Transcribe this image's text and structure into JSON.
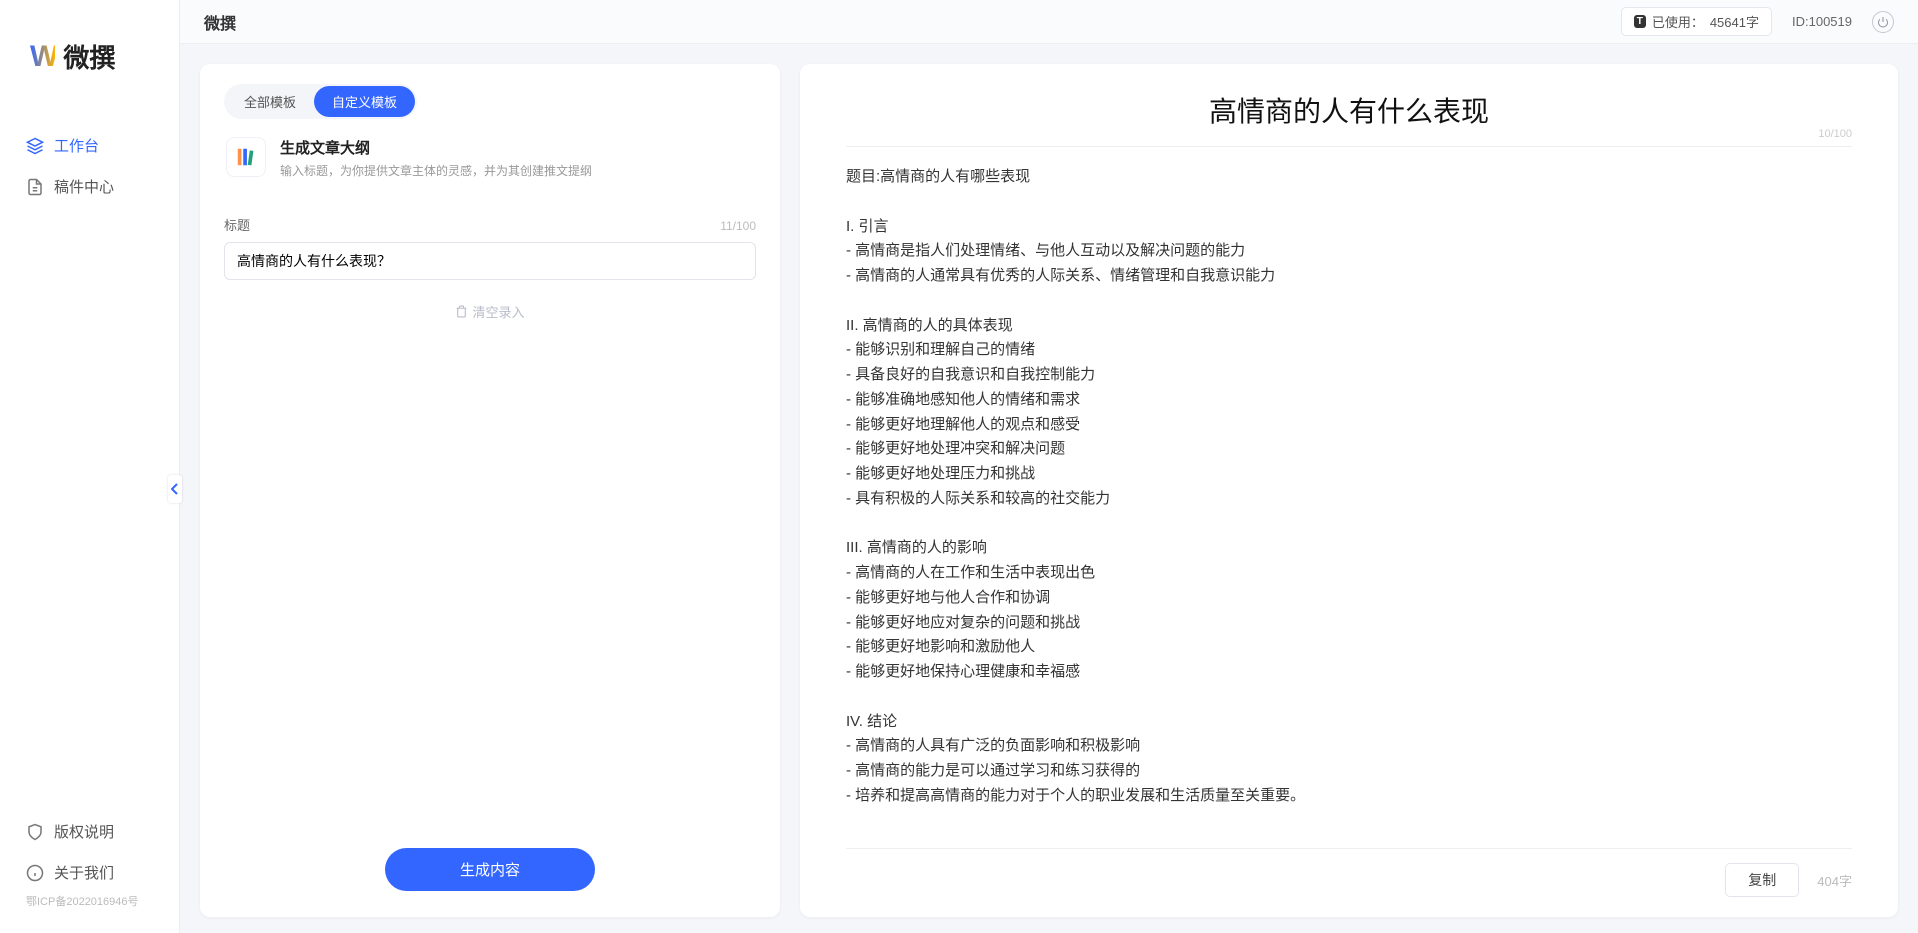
{
  "app": {
    "logo_text": "微撰",
    "top_title": "微撰",
    "usage_label": "已使用：",
    "usage_value": "45641字",
    "id_label": "ID:",
    "id_value": "100519"
  },
  "sidebar": {
    "items": [
      {
        "label": "工作台",
        "active": true
      },
      {
        "label": "稿件中心",
        "active": false
      }
    ],
    "bottom": [
      {
        "label": "版权说明"
      },
      {
        "label": "关于我们"
      }
    ],
    "icp": "鄂ICP备2022016946号"
  },
  "left_panel": {
    "tabs": [
      {
        "label": "全部模板",
        "active": false
      },
      {
        "label": "自定义模板",
        "active": true
      }
    ],
    "template": {
      "title": "生成文章大纲",
      "desc": "输入标题，为你提供文章主体的灵感，并为其创建推文提纲"
    },
    "field": {
      "label": "标题",
      "count": "11/100",
      "value": "高情商的人有什么表现？"
    },
    "clear_link": "清空录入",
    "generate_btn": "生成内容"
  },
  "doc": {
    "title": "高情商的人有什么表现",
    "title_count": "10/100",
    "body": "题目:高情商的人有哪些表现\n\nI. 引言\n- 高情商是指人们处理情绪、与他人互动以及解决问题的能力\n- 高情商的人通常具有优秀的人际关系、情绪管理和自我意识能力\n\nII. 高情商的人的具体表现\n- 能够识别和理解自己的情绪\n- 具备良好的自我意识和自我控制能力\n- 能够准确地感知他人的情绪和需求\n- 能够更好地理解他人的观点和感受\n- 能够更好地处理冲突和解决问题\n- 能够更好地处理压力和挑战\n- 具有积极的人际关系和较高的社交能力\n\nIII. 高情商的人的影响\n- 高情商的人在工作和生活中表现出色\n- 能够更好地与他人合作和协调\n- 能够更好地应对复杂的问题和挑战\n- 能够更好地影响和激励他人\n- 能够更好地保持心理健康和幸福感\n\nIV. 结论\n- 高情商的人具有广泛的负面影响和积极影响\n- 高情商的能力是可以通过学习和练习获得的\n- 培养和提高高情商的能力对于个人的职业发展和生活质量至关重要。",
    "copy_btn": "复制",
    "word_count": "404字"
  }
}
